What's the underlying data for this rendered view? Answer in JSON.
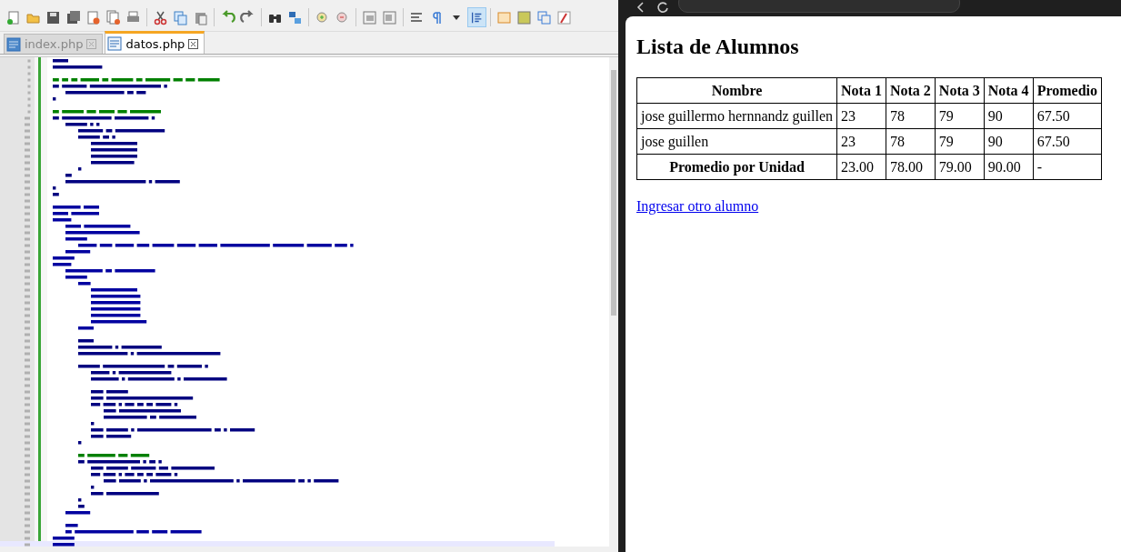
{
  "editor": {
    "tabs": [
      {
        "label": "index.php",
        "selected": false
      },
      {
        "label": "datos.php",
        "selected": true
      }
    ]
  },
  "browser": {
    "heading": "Lista de Alumnos",
    "table": {
      "columns": [
        "Nombre",
        "Nota 1",
        "Nota 2",
        "Nota 3",
        "Nota 4",
        "Promedio"
      ],
      "rows": [
        {
          "kind": "data",
          "cells": [
            "jose guillermo hernnandz guillen",
            "23",
            "78",
            "79",
            "90",
            "67.50"
          ]
        },
        {
          "kind": "data",
          "cells": [
            "jose guillen",
            "23",
            "78",
            "79",
            "90",
            "67.50"
          ]
        },
        {
          "kind": "summary",
          "cells": [
            "Promedio por Unidad",
            "23.00",
            "78.00",
            "79.00",
            "90.00",
            "-"
          ]
        }
      ]
    },
    "link": "Ingresar otro alumno"
  }
}
